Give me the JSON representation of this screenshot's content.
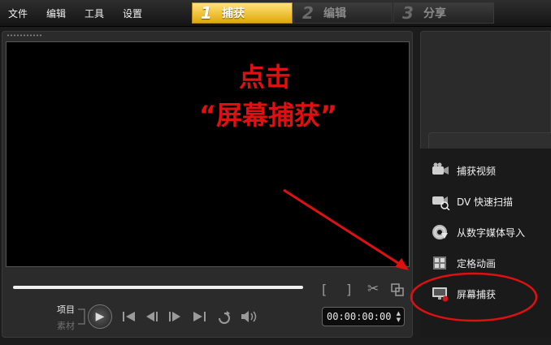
{
  "menu": [
    "文件",
    "编辑",
    "工具",
    "设置"
  ],
  "steps": [
    {
      "num": "1",
      "label": "捕获",
      "state": "active"
    },
    {
      "num": "2",
      "label": "编辑",
      "state": "inactive"
    },
    {
      "num": "3",
      "label": "分享",
      "state": "inactive"
    }
  ],
  "annotation": {
    "line1": "点击",
    "line2": "“屏幕捕获”",
    "color": "#e01010"
  },
  "playback": {
    "mode_project": "项目",
    "mode_clip": "素材",
    "timecode": "00:00:00:00"
  },
  "capture_options": [
    {
      "label": "捕获视频",
      "icon": "video-camera-icon"
    },
    {
      "label": "DV 快速扫描",
      "icon": "dv-scan-icon"
    },
    {
      "label": "从数字媒体导入",
      "icon": "disc-import-icon"
    },
    {
      "label": "定格动画",
      "icon": "stop-motion-icon"
    },
    {
      "label": "屏幕捕获",
      "icon": "screen-capture-icon"
    }
  ],
  "colors": {
    "active_step": "#e8b315",
    "annotation_red": "#e01010",
    "background": "#1c1c1c"
  }
}
